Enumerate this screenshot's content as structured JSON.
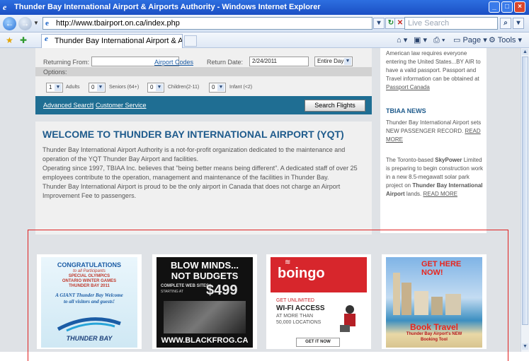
{
  "browser": {
    "title": "Thunder Bay International Airport & Airports Authority - Windows Internet Explorer",
    "url": "http://www.tbairport.on.ca/index.php",
    "search_placeholder": "Live Search",
    "tab_label": "Thunder Bay International Airport & Air...",
    "toolbar": {
      "page": "Page",
      "tools": "Tools"
    }
  },
  "search_form": {
    "returning_from_label": "Returning From:",
    "airport_codes_link": "Airport Codes",
    "return_date_label": "Return Date:",
    "return_date_value": "2/24/2011",
    "time_value": "Entire Day",
    "options_label": "Options:",
    "adults_value": "1",
    "adults_label": "Adults",
    "seniors_value": "0",
    "seniors_label": "Seniors (64+)",
    "children_value": "0",
    "children_label": "Children(2-11)",
    "infant_value": "0",
    "infant_label": "Infant (<2)",
    "advanced_search_link": "Advanced Search",
    "separator": "|",
    "customer_service_link": "Customer Service",
    "search_button": "Search Flights"
  },
  "welcome": {
    "title": "WELCOME TO THUNDER BAY INTERNATIONAL AIRPORT (YQT)",
    "p1": "Thunder Bay International Airport Authority is a not-for-profit organization dedicated to the maintenance and operation of the YQT Thunder Bay Airport and facilities.",
    "p2": "Operating since 1997, TBIAA Inc. believes that \"being better means being different\". A dedicated staff of over 25 employees contribute to the operation, management and maintenance of the facilities in Thunder Bay.",
    "p3": "Thunder Bay International Airport is proud to be the only airport in Canada that does not charge an Airport Improvement Fee to passengers."
  },
  "sidebar": {
    "passport_text": "American law requires everyone entering the United States...BY AIR to have a valid passport. Passport and Travel information can be obtained at",
    "passport_link": "Passport Canada",
    "news_heading": "TBIAA NEWS",
    "news1_text": "Thunder Bay International Airport sets NEW PASSENGER RECORD.",
    "read_more_1": "READ MORE",
    "news2_a": "The Toronto-based",
    "news2_b": "SkyPower",
    "news2_c": "Limited is preparing to begin construction work in a new 8.5-megawatt solar park project on",
    "news2_d": "Thunder Bay International Airport",
    "news2_e": "lands.",
    "read_more_2": "READ MORE"
  },
  "ads": {
    "olympics": {
      "l1": "CONGRATULATIONS",
      "l2": "to all Participants",
      "l3": "SPECIAL OLYMPICS",
      "l4": "ONTARIO WINTER GAMES",
      "l5": "THUNDER BAY 2011",
      "l6": "A GIANT Thunder Bay Welcome",
      "l7": "to all visitors and guests!",
      "logo": "THUNDER BAY"
    },
    "blackfrog": {
      "l1": "BLOW MINDS...",
      "l2": "NOT BUDGETS",
      "l3": "COMPLETE WEB SITES",
      "l4": "STARTING AT",
      "price": "$499",
      "url": "WWW.BLACKFROG.CA"
    },
    "boingo": {
      "brand": "boingo",
      "l1": "GET UNLIMITED",
      "l2": "WI-FI ACCESS",
      "l3": "AT MORE THAN",
      "l4": "50,000 LOCATIONS",
      "cta": "GET IT NOW"
    },
    "travel": {
      "l1": "GET HERE NOW!",
      "l2": "Book Travel",
      "l3": "Thunder Bay Airport's NEW",
      "l4": "Booking Tool"
    }
  },
  "colors": {
    "title_blue": "#1f5b8c",
    "search_bar_blue": "#1f6e93",
    "highlight_red": "#e02020"
  }
}
